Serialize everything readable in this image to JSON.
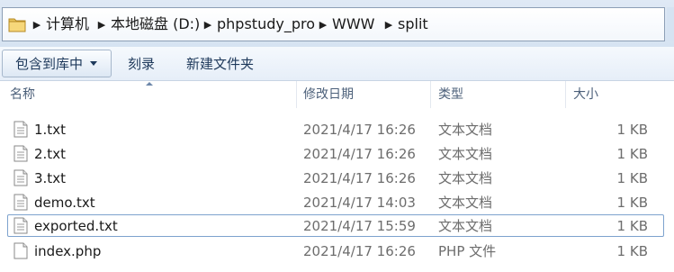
{
  "address": {
    "crumbs": [
      "计算机",
      "本地磁盘 (D:)",
      "phpstudy_pro",
      "WWW",
      "split"
    ]
  },
  "toolbar": {
    "include_in_library": "包含到库中",
    "burn": "刻录",
    "new_folder": "新建文件夹"
  },
  "columns": {
    "name": "名称",
    "modified": "修改日期",
    "type": "类型",
    "size": "大小"
  },
  "files": [
    {
      "name": "1.txt",
      "modified": "2021/4/17 16:26",
      "type": "文本文档",
      "size": "1 KB",
      "icon": "text-file-icon"
    },
    {
      "name": "2.txt",
      "modified": "2021/4/17 16:26",
      "type": "文本文档",
      "size": "1 KB",
      "icon": "text-file-icon"
    },
    {
      "name": "3.txt",
      "modified": "2021/4/17 16:26",
      "type": "文本文档",
      "size": "1 KB",
      "icon": "text-file-icon"
    },
    {
      "name": "demo.txt",
      "modified": "2021/4/17 14:03",
      "type": "文本文档",
      "size": "1 KB",
      "icon": "text-file-icon"
    },
    {
      "name": "exported.txt",
      "modified": "2021/4/17 15:59",
      "type": "文本文档",
      "size": "1 KB",
      "icon": "text-file-icon"
    },
    {
      "name": "index.php",
      "modified": "2021/4/17 16:26",
      "type": "PHP 文件",
      "size": "1 KB",
      "icon": "generic-file-icon"
    }
  ]
}
